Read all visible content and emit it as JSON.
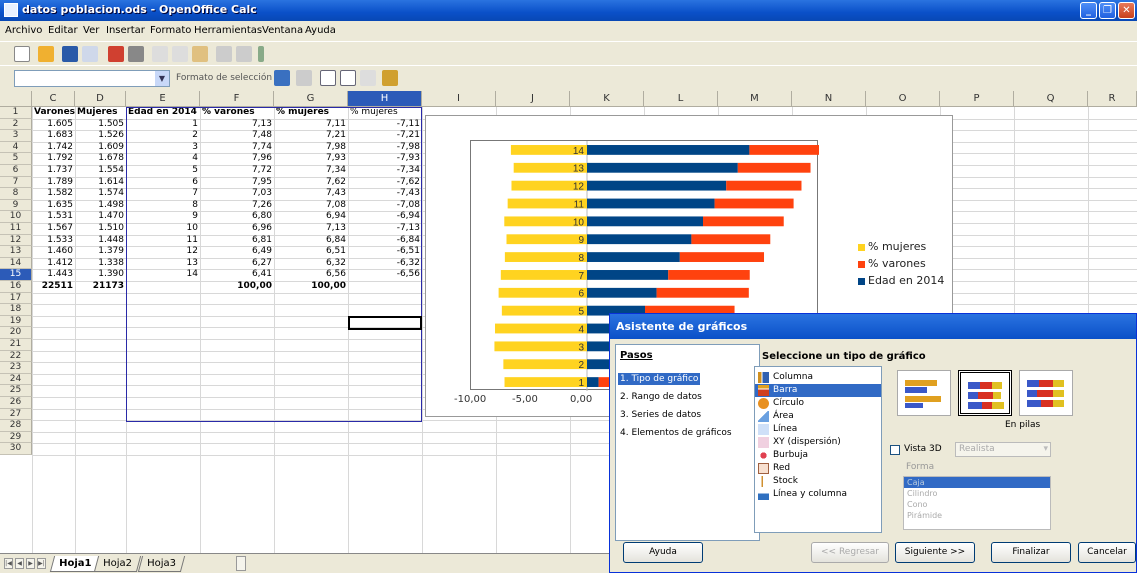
{
  "window": {
    "title": "datos poblacion.ods - OpenOffice Calc",
    "controls": [
      "_",
      "❐",
      "✕"
    ]
  },
  "menu": [
    "Archivo",
    "Editar",
    "Ver",
    "Insertar",
    "Formato",
    "Herramientas",
    "Ventana",
    "Ayuda"
  ],
  "formatbar": {
    "name_box": "",
    "format_label": "Formato de selección"
  },
  "columns": [
    "C",
    "D",
    "E",
    "F",
    "G",
    "H",
    "I",
    "J",
    "K",
    "L",
    "M",
    "N",
    "O",
    "P",
    "Q",
    "R"
  ],
  "rows": [
    "1",
    "2",
    "3",
    "4",
    "5",
    "6",
    "7",
    "8",
    "9",
    "10",
    "11",
    "12",
    "13",
    "14",
    "15",
    "16",
    "17",
    "18",
    "19",
    "20",
    "21",
    "22",
    "23",
    "24",
    "25",
    "26",
    "27",
    "28",
    "29",
    "30"
  ],
  "table": {
    "headers": [
      "Varones",
      "Mujeres",
      "Edad en 2014",
      "% varones",
      "% mujeres",
      "% mujeres"
    ],
    "rows": [
      [
        "1.605",
        "1.505",
        "1",
        "7,13",
        "7,11",
        "-7,11"
      ],
      [
        "1.683",
        "1.526",
        "2",
        "7,48",
        "7,21",
        "-7,21"
      ],
      [
        "1.742",
        "1.609",
        "3",
        "7,74",
        "7,98",
        "-7,98"
      ],
      [
        "1.792",
        "1.678",
        "4",
        "7,96",
        "7,93",
        "-7,93"
      ],
      [
        "1.737",
        "1.554",
        "5",
        "7,72",
        "7,34",
        "-7,34"
      ],
      [
        "1.789",
        "1.614",
        "6",
        "7,95",
        "7,62",
        "-7,62"
      ],
      [
        "1.582",
        "1.574",
        "7",
        "7,03",
        "7,43",
        "-7,43"
      ],
      [
        "1.635",
        "1.498",
        "8",
        "7,26",
        "7,08",
        "-7,08"
      ],
      [
        "1.531",
        "1.470",
        "9",
        "6,80",
        "6,94",
        "-6,94"
      ],
      [
        "1.567",
        "1.510",
        "10",
        "6,96",
        "7,13",
        "-7,13"
      ],
      [
        "1.533",
        "1.448",
        "11",
        "6,81",
        "6,84",
        "-6,84"
      ],
      [
        "1.460",
        "1.379",
        "12",
        "6,49",
        "6,51",
        "-6,51"
      ],
      [
        "1.412",
        "1.338",
        "13",
        "6,27",
        "6,32",
        "-6,32"
      ],
      [
        "1.443",
        "1.390",
        "14",
        "6,41",
        "6,56",
        "-6,56"
      ]
    ],
    "totals": [
      "22511",
      "21173",
      "",
      "100,00",
      "100,00",
      ""
    ]
  },
  "chart_data": {
    "type": "bar",
    "orientation": "horizontal",
    "stacked": true,
    "categories": [
      "1",
      "2",
      "3",
      "4",
      "5",
      "6",
      "7",
      "8",
      "9",
      "10",
      "11",
      "12",
      "13",
      "14"
    ],
    "series": [
      {
        "name": "% mujeres",
        "color": "#ffd320",
        "values": [
          -7.11,
          -7.21,
          -7.98,
          -7.93,
          -7.34,
          -7.62,
          -7.43,
          -7.08,
          -6.94,
          -7.13,
          -6.84,
          -6.51,
          -6.32,
          -6.56
        ]
      },
      {
        "name": "% varones",
        "color": "#ff420e",
        "values": [
          7.13,
          7.48,
          7.74,
          7.96,
          7.72,
          7.95,
          7.03,
          7.26,
          6.8,
          6.96,
          6.81,
          6.49,
          6.27,
          6.41
        ]
      },
      {
        "name": "Edad en 2014",
        "color": "#004586",
        "values": [
          1,
          2,
          3,
          4,
          5,
          6,
          7,
          8,
          9,
          10,
          11,
          12,
          13,
          14
        ]
      }
    ],
    "x_ticks": [
      "-10,00",
      "-5,00",
      "0,00"
    ],
    "xlim": [
      -10,
      20
    ],
    "legend_position": "right"
  },
  "sheet_tabs": [
    "Hoja1",
    "Hoja2",
    "Hoja3"
  ],
  "dialog": {
    "title": "Asistente de gráficos",
    "steps_title": "Pasos",
    "steps": [
      "1. Tipo de gráfico",
      "2. Rango de datos",
      "3. Series de datos",
      "4. Elementos de gráficos"
    ],
    "select_title": "Seleccione un tipo de gráfico",
    "chart_types": [
      "Columna",
      "Barra",
      "Círculo",
      "Área",
      "Línea",
      "XY (dispersión)",
      "Burbuja",
      "Red",
      "Stock",
      "Línea y columna"
    ],
    "variant_label": "En pilas",
    "vista3d_label": "Vista 3D",
    "realista": "Realista",
    "forma_label": "Forma",
    "shapes": [
      "Caja",
      "Cilindro",
      "Cono",
      "Pirámide"
    ],
    "buttons": {
      "help": "Ayuda",
      "back": "<< Regresar",
      "next": "Siguiente >>",
      "finish": "Finalizar",
      "cancel": "Cancelar"
    }
  }
}
